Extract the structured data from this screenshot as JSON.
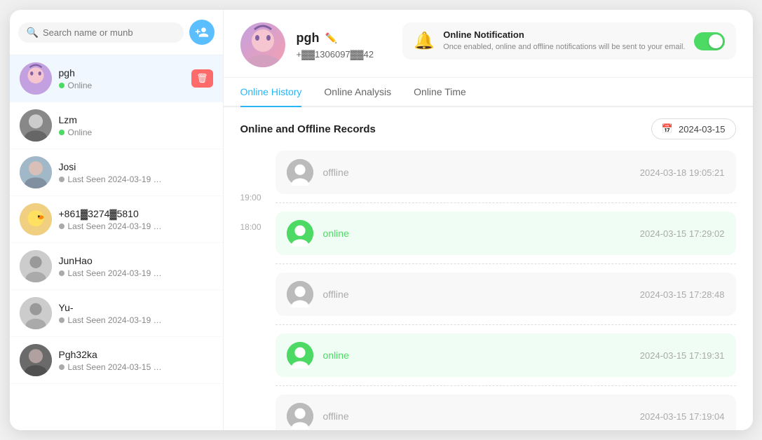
{
  "sidebar": {
    "search_placeholder": "Search name or munb",
    "add_btn_label": "+",
    "contacts": [
      {
        "id": "pgh",
        "name": "pgh",
        "status": "Online",
        "status_type": "online",
        "avatar_type": "pgh",
        "active": true,
        "show_delete": true
      },
      {
        "id": "lzm",
        "name": "Lzm",
        "status": "Online",
        "status_type": "online",
        "avatar_type": "lzm",
        "active": false,
        "show_delete": false
      },
      {
        "id": "josi",
        "name": "Josi",
        "status": "Last Seen 2024-03-19 …",
        "status_type": "offline",
        "avatar_type": "josi",
        "active": false,
        "show_delete": false
      },
      {
        "id": "phone",
        "name": "+861▓3274▓5810",
        "status": "Last Seen 2024-03-19 …",
        "status_type": "offline",
        "avatar_type": "duck",
        "active": false,
        "show_delete": false
      },
      {
        "id": "junhao",
        "name": "JunHao",
        "status": "Last Seen 2024-03-19 …",
        "status_type": "offline",
        "avatar_type": "generic",
        "active": false,
        "show_delete": false
      },
      {
        "id": "yu",
        "name": "Yu-",
        "status": "Last Seen 2024-03-19 …",
        "status_type": "offline",
        "avatar_type": "generic",
        "active": false,
        "show_delete": false
      },
      {
        "id": "pgh32ka",
        "name": "Pgh32ka",
        "status": "Last Seen 2024-03-15 …",
        "status_type": "offline",
        "avatar_type": "pgh32ka",
        "active": false,
        "show_delete": false
      }
    ]
  },
  "profile": {
    "name": "pgh",
    "phone": "+▓▓1306097▓▓42",
    "avatar_type": "pgh"
  },
  "notification": {
    "title": "Online Notification",
    "description": "Once enabled, online and offline notifications will be sent to your email.",
    "enabled": true
  },
  "tabs": [
    {
      "id": "history",
      "label": "Online History",
      "active": true
    },
    {
      "id": "analysis",
      "label": "Online Analysis",
      "active": false
    },
    {
      "id": "time",
      "label": "Online Time",
      "active": false
    }
  ],
  "records": {
    "title": "Online and Offline Records",
    "date": "2024-03-15",
    "timeline_labels": [
      "19:00",
      "18:00"
    ],
    "items": [
      {
        "type": "offline",
        "status_label": "offline",
        "timestamp": "2024-03-18 19:05:21"
      },
      {
        "type": "online",
        "status_label": "online",
        "timestamp": "2024-03-15 17:29:02"
      },
      {
        "type": "offline",
        "status_label": "offline",
        "timestamp": "2024-03-15 17:28:48"
      },
      {
        "type": "online",
        "status_label": "online",
        "timestamp": "2024-03-15 17:19:31"
      },
      {
        "type": "offline",
        "status_label": "offline",
        "timestamp": "2024-03-15 17:19:04"
      }
    ]
  }
}
